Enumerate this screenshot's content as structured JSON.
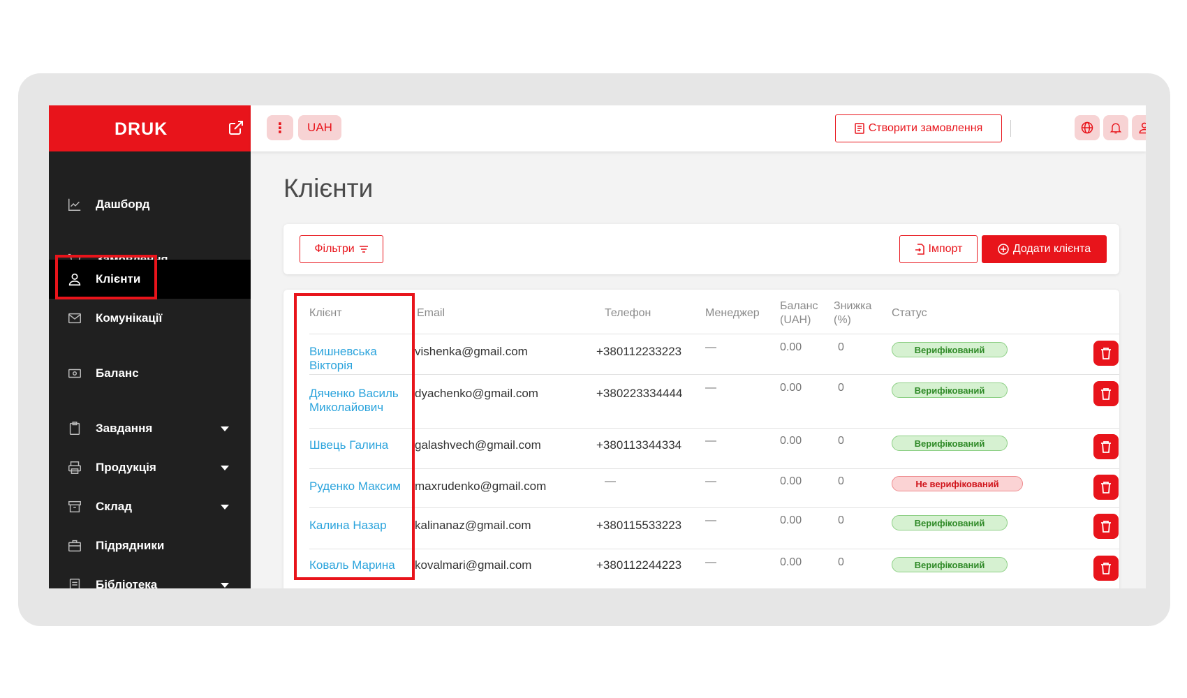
{
  "brand": {
    "name": "DRUK"
  },
  "nav": [
    {
      "key": "dashboard",
      "label": "Дашборд",
      "icon": "chart-icon"
    },
    {
      "key": "orders",
      "label": "Замовлення",
      "icon": "cart-icon"
    },
    {
      "key": "clients",
      "label": "Клієнти",
      "icon": "user-icon",
      "active": true
    },
    {
      "key": "communications",
      "label": "Комунікації",
      "icon": "envelope-icon"
    },
    {
      "key": "balance",
      "label": "Баланс",
      "icon": "money-icon"
    },
    {
      "key": "tasks",
      "label": "Завдання",
      "icon": "clipboard-icon",
      "expandable": true
    },
    {
      "key": "products",
      "label": "Продукція",
      "icon": "printer-icon",
      "expandable": true
    },
    {
      "key": "warehouse",
      "label": "Склад",
      "icon": "archive-icon",
      "expandable": true
    },
    {
      "key": "contractors",
      "label": "Підрядники",
      "icon": "briefcase-icon"
    },
    {
      "key": "library",
      "label": "Бібліотека",
      "icon": "book-icon",
      "expandable": true
    }
  ],
  "topbar": {
    "dots": "⋮",
    "currency": "UAH",
    "create_order": "Створити замовлення"
  },
  "page": {
    "title": "Клієнти",
    "filters_label": "Фільтри",
    "import_label": "Імпорт",
    "add_client_label": "Додати клієнта"
  },
  "table": {
    "headers": {
      "client": "Клієнт",
      "email": "Email",
      "phone": "Телефон",
      "manager": "Менеджер",
      "balance_line1": "Баланс",
      "balance_line2": "(UAH)",
      "discount_line1": "Знижка",
      "discount_line2": "(%)",
      "status": "Статус"
    },
    "rows": [
      {
        "name": "Вишневська Вікторія",
        "email": "vishenka@gmail.com",
        "phone": "+380112233223",
        "manager": "—",
        "balance": "0.00",
        "discount": "0",
        "status": "Верифікований",
        "verified": true
      },
      {
        "name": "Дяченко Василь Миколайович",
        "email": "dyachenko@gmail.com",
        "phone": "+380223334444",
        "manager": "—",
        "balance": "0.00",
        "discount": "0",
        "status": "Верифікований",
        "verified": true
      },
      {
        "name": "Швець Галина",
        "email": "galashvech@gmail.com",
        "phone": "+380113344334",
        "manager": "—",
        "balance": "0.00",
        "discount": "0",
        "status": "Верифікований",
        "verified": true
      },
      {
        "name": "Руденко Максим",
        "email": "maxrudenko@gmail.com",
        "phone": "—",
        "manager": "—",
        "balance": "0.00",
        "discount": "0",
        "status": "Не верифікований",
        "verified": false
      },
      {
        "name": "Калина Назар",
        "email": "kalinanaz@gmail.com",
        "phone": "+380115533223",
        "manager": "—",
        "balance": "0.00",
        "discount": "0",
        "status": "Верифікований",
        "verified": true
      },
      {
        "name": "Коваль Марина",
        "email": "kovalmari@gmail.com",
        "phone": "+380112244223",
        "manager": "—",
        "balance": "0.00",
        "discount": "0",
        "status": "Верифікований",
        "verified": true
      }
    ]
  },
  "colors": {
    "accent": "#e8141b",
    "sidebar_bg": "#202020",
    "link": "#2aa3dc",
    "verified_bg": "#d6f1d1",
    "unverified_bg": "#fbd3d4"
  }
}
